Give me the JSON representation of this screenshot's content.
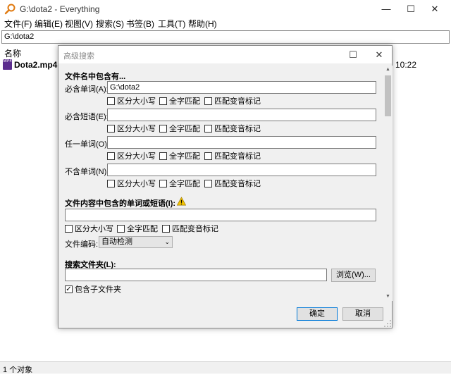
{
  "window": {
    "title": "G:\\dota2 - Everything"
  },
  "menu": {
    "items": [
      "文件(F)",
      "编辑(E)",
      "视图(V)",
      "搜索(S)",
      "书签(B)",
      "工具(T)",
      "帮助(H)"
    ]
  },
  "search": {
    "value": "G:\\dota2"
  },
  "results": {
    "column_name": "名称",
    "rows": [
      {
        "icon_text": "MP4",
        "name": "Dota2.mp4",
        "time": "10:22"
      }
    ]
  },
  "status": {
    "text": "1 个对象"
  },
  "dialog": {
    "title": "高级搜索",
    "filename_section": "文件名中包含有...",
    "rows": [
      {
        "label": "必含单词(A):",
        "value": "G:\\dota2"
      },
      {
        "label": "必含短语(E):",
        "value": ""
      },
      {
        "label": "任一单词(O):",
        "value": ""
      },
      {
        "label": "不含单词(N):",
        "value": ""
      }
    ],
    "options": {
      "case": "区分大小写",
      "whole": "全字匹配",
      "diacritics": "匹配变音标记"
    },
    "content_section": "文件内容中包含的单词或短语(I):",
    "content_value": "",
    "encoding_label": "文件编码:",
    "encoding_value": "自动检测",
    "folder_section": "搜索文件夹(L):",
    "folder_value": "",
    "browse_label": "浏览(W)...",
    "subfolders_label": "包含子文件夹",
    "subfolders_checked": true,
    "ok_label": "确定",
    "cancel_label": "取消"
  },
  "colors": {
    "accent": "#0078d7",
    "mp4_icon": "#5b2d8e",
    "warning": "#f5c400"
  },
  "icons": {
    "app": "magnifier-icon",
    "warning": "warning-icon",
    "file": "mp4-file-icon"
  }
}
